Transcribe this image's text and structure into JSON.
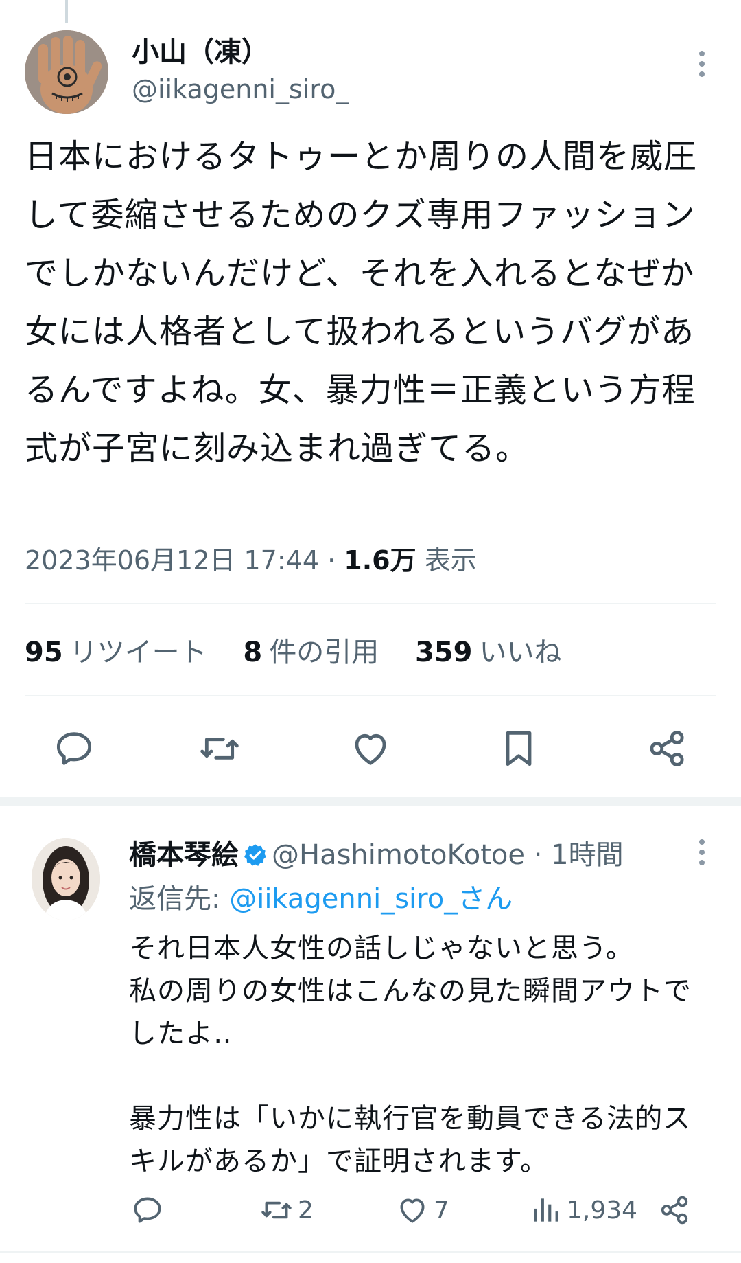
{
  "main_tweet": {
    "name": "小山（凍）",
    "handle": "@iikagenni_siro_",
    "text": "日本におけるタトゥーとか周りの人間を威圧して委縮させるためのクズ専用ファッションでしかないんだけど、それを入れるとなぜか女には人格者として扱われるというバグがあるんですよね。女、暴力性＝正義という方程式が子宮に刻み込まれ過ぎてる。",
    "timestamp": "2023年06月12日 17:44",
    "views_separator": "·",
    "views_count": "1.6万",
    "views_label": "表示",
    "stats": {
      "retweets_count": "95",
      "retweets_label": "リツイート",
      "quotes_count": "8",
      "quotes_label": "件の引用",
      "likes_count": "359",
      "likes_label": "いいね"
    }
  },
  "reply": {
    "name": "橋本琴絵",
    "handle": "@HashimotoKotoe",
    "time": "· 1時間",
    "reply_to_prefix": "返信先: ",
    "reply_to_mention": "@iikagenni_siro_さん",
    "text": "それ日本人女性の話しじゃないと思う。\n私の周りの女性はこんなの見た瞬間アウトでしたよ‥\n\n暴力性は「いかに執行官を動員できる法的スキルがあるか」で証明されます。",
    "retweets": "2",
    "likes": "7",
    "views": "1,934"
  },
  "colors": {
    "text": "#0f1419",
    "secondary": "#536471",
    "accent": "#1d9bf0",
    "divider": "#eff3f4"
  },
  "icons": [
    "more-icon",
    "reply-icon",
    "retweet-icon",
    "like-icon",
    "bookmark-icon",
    "share-icon",
    "verified-badge-icon",
    "views-icon"
  ]
}
